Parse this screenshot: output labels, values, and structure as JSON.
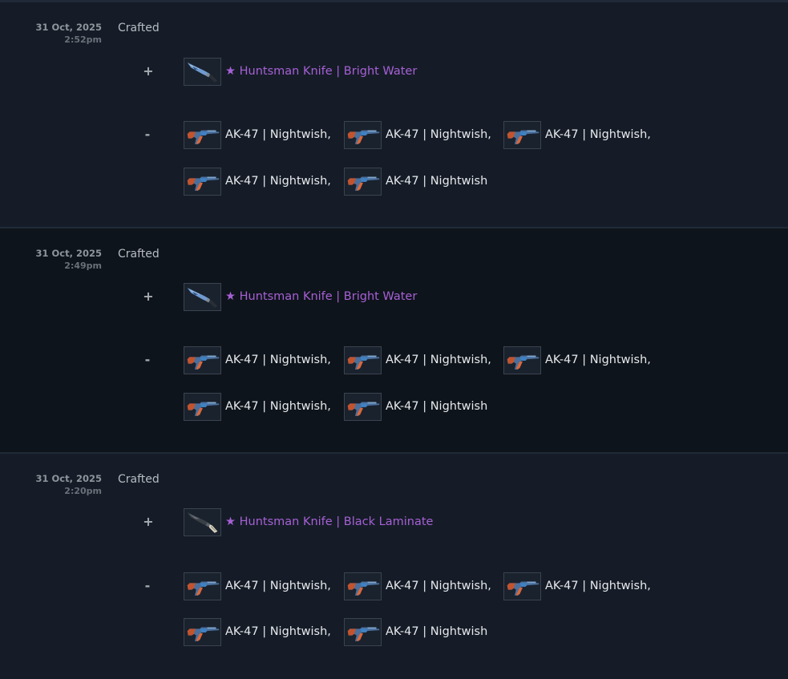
{
  "entries": [
    {
      "date": "31 Oct, 2025",
      "time": "2:52pm",
      "action": "Crafted",
      "plus_sign": "+",
      "minus_sign": "-",
      "received": {
        "name": "★ Huntsman Knife | Bright Water",
        "icon": "huntsman-knife-bright-water-icon"
      },
      "lost": [
        {
          "name": "AK-47 | Nightwish,"
        },
        {
          "name": "AK-47 | Nightwish,"
        },
        {
          "name": "AK-47 | Nightwish,"
        },
        {
          "name": "AK-47 | Nightwish,"
        },
        {
          "name": "AK-47 | Nightwish"
        }
      ]
    },
    {
      "date": "31 Oct, 2025",
      "time": "2:49pm",
      "action": "Crafted",
      "plus_sign": "+",
      "minus_sign": "-",
      "received": {
        "name": "★ Huntsman Knife | Bright Water",
        "icon": "huntsman-knife-bright-water-icon"
      },
      "lost": [
        {
          "name": "AK-47 | Nightwish,"
        },
        {
          "name": "AK-47 | Nightwish,"
        },
        {
          "name": "AK-47 | Nightwish,"
        },
        {
          "name": "AK-47 | Nightwish,"
        },
        {
          "name": "AK-47 | Nightwish"
        }
      ]
    },
    {
      "date": "31 Oct, 2025",
      "time": "2:20pm",
      "action": "Crafted",
      "plus_sign": "+",
      "minus_sign": "-",
      "received": {
        "name": "★ Huntsman Knife | Black Laminate",
        "icon": "huntsman-knife-black-laminate-icon"
      },
      "lost": [
        {
          "name": "AK-47 | Nightwish,"
        },
        {
          "name": "AK-47 | Nightwish,"
        },
        {
          "name": "AK-47 | Nightwish,"
        },
        {
          "name": "AK-47 | Nightwish,"
        },
        {
          "name": "AK-47 | Nightwish"
        }
      ]
    }
  ],
  "colors": {
    "background": "#151c27",
    "alt_background": "#0e141b",
    "covert_item": "#a760d6",
    "item_text": "#e6e9ec"
  }
}
